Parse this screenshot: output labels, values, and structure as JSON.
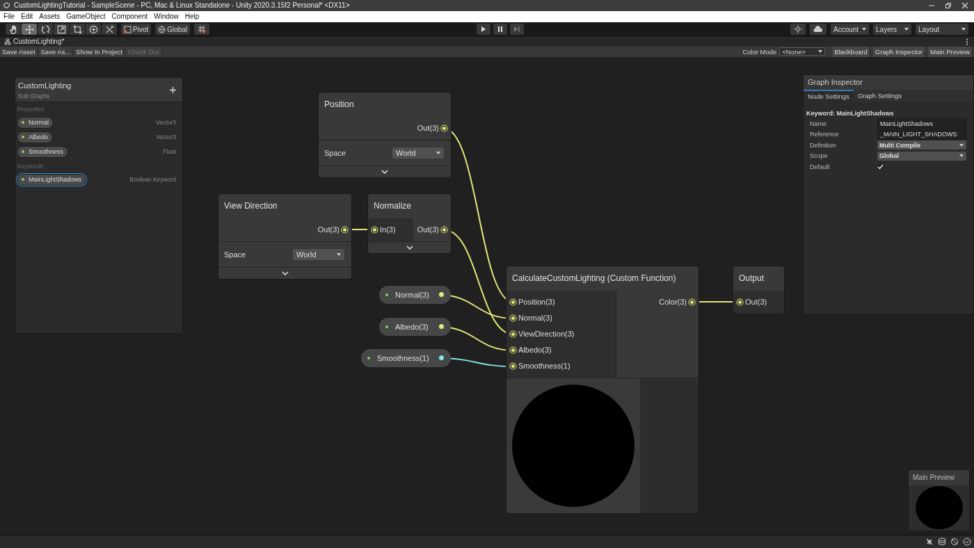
{
  "window": {
    "title": "CustomLightingTutorial - SampleScene - PC, Mac & Linux Standalone - Unity 2020.3.15f2 Personal* <DX11>"
  },
  "menu": [
    "File",
    "Edit",
    "Assets",
    "GameObject",
    "Component",
    "Window",
    "Help"
  ],
  "toolbar": {
    "tools": [
      {
        "selected": false
      },
      {
        "selected": true
      },
      {
        "selected": false
      },
      {
        "selected": false
      },
      {
        "selected": false
      },
      {
        "selected": false
      },
      {
        "selected": false
      }
    ],
    "pivot": "Pivot",
    "global": "Global",
    "account": "Account",
    "layers": "Layers",
    "layout": "Layout"
  },
  "tab": {
    "label": "CustomLighting*"
  },
  "graph_toolbar": {
    "buttons": [
      {
        "label": "Save Asset",
        "disabled": false
      },
      {
        "label": "Save As...",
        "disabled": false
      },
      {
        "label": "Show In Project",
        "disabled": false
      },
      {
        "label": "Check Out",
        "disabled": true
      }
    ],
    "color_mode_label": "Color Mode",
    "color_mode": "<None>",
    "toggles": [
      "Blackboard",
      "Graph Inspector",
      "Main Preview"
    ]
  },
  "blackboard": {
    "title": "CustomLighting",
    "subtitle": "Sub Graphs",
    "sections": [
      {
        "heading": "Properties",
        "items": [
          {
            "name": "Normal",
            "type": "Vector3",
            "selected": false
          },
          {
            "name": "Albedo",
            "type": "Vector3",
            "selected": false
          },
          {
            "name": "Smoothness",
            "type": "Float",
            "selected": false
          }
        ]
      },
      {
        "heading": "Keywords",
        "items": [
          {
            "name": "MainLightShadows",
            "type": "Boolean Keyword",
            "selected": true
          }
        ]
      }
    ]
  },
  "nodes": [
    {
      "title": "Position",
      "outputs": [
        "Out(3)"
      ],
      "control": {
        "label": "Space",
        "value": "World"
      },
      "expand": true
    },
    {
      "title": "View Direction",
      "outputs": [
        "Out(3)"
      ],
      "control": {
        "label": "Space",
        "value": "World"
      },
      "expand": true
    },
    {
      "title": "Normalize",
      "inputs": [
        "In(3)"
      ],
      "outputs": [
        "Out(3)"
      ],
      "expand": true
    },
    {
      "title": "CalculateCustomLighting (Custom Function)",
      "inputs": [
        "Position(3)",
        "Normal(3)",
        "ViewDirection(3)",
        "Albedo(3)",
        "Smoothness(1)"
      ],
      "outputs": [
        "Color(3)"
      ],
      "preview": true
    },
    {
      "title": "Output",
      "inputs": [
        "Out(3)"
      ]
    }
  ],
  "property_nodes": [
    {
      "label": "Normal(3)",
      "color": "#e6e67a"
    },
    {
      "label": "Albedo(3)",
      "color": "#e6e67a"
    },
    {
      "label": "Smoothness(1)",
      "color": "#84e4e7"
    }
  ],
  "inspector": {
    "title": "Graph Inspector",
    "tabs": [
      {
        "label": "Node Settings",
        "selected": true
      },
      {
        "label": "Graph Settings",
        "selected": false
      }
    ],
    "heading": "Keyword: MainLightShadows",
    "fields": [
      {
        "label": "Name",
        "kind": "text",
        "value": "MainLightShadows"
      },
      {
        "label": "Reference",
        "kind": "text",
        "value": "_MAIN_LIGHT_SHADOWS"
      },
      {
        "label": "Definition",
        "kind": "dropdown",
        "value": "Multi Compile"
      },
      {
        "label": "Scope",
        "kind": "dropdown",
        "value": "Global"
      },
      {
        "label": "Default",
        "kind": "checkbox",
        "checked": true
      }
    ]
  },
  "main_preview": {
    "title": "Main Preview"
  }
}
